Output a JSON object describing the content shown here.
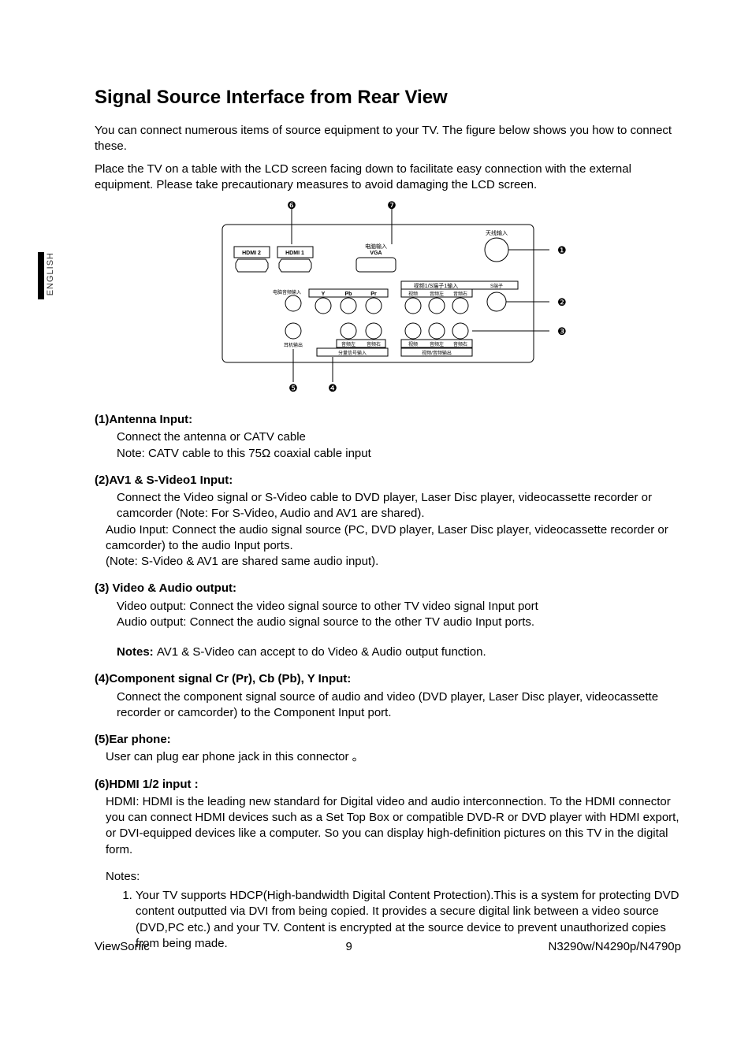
{
  "sideTab": "ENGLISH",
  "title": "Signal Source Interface from Rear View",
  "intro1": "You can connect numerous items of source equipment to your TV. The figure below shows you how to connect these.",
  "intro2": "Place the TV on a table with the LCD screen facing down to facilitate easy connection with the external equipment. Please take precautionary measures to avoid damaging the LCD screen.",
  "diagram": {
    "callouts": {
      "c1": "❶",
      "c2": "❷",
      "c3": "❸",
      "c4": "❹",
      "c5": "❺",
      "c6": "❻",
      "c7": "❼"
    },
    "labels": {
      "hdmi2": "HDMI 2",
      "hdmi1": "HDMI 1",
      "vga_top": "电脑输入",
      "vga_bot": "VGA",
      "ant": "天线输入",
      "row2hdr": "视频1/S端子1输入",
      "svideo": "S端子",
      "pcaudio": "电脑音频输入",
      "y": "Y",
      "pb": "Pb",
      "pr": "Pr",
      "vid": "视频",
      "aL": "音频左",
      "aR": "音频右",
      "ear": "耳机输出",
      "comp_in": "分量信号输入",
      "av_out": "视频/音频输出",
      "aL2": "音频左",
      "aR2": "音频右",
      "vid2": "视频",
      "aL3": "音频左",
      "aR3": "音频右"
    }
  },
  "items": [
    {
      "head": "(1)Antenna Input:",
      "body": [
        "Connect the antenna or CATV cable",
        "Note: CATV cable to this 75Ω coaxial cable input"
      ]
    },
    {
      "head": "(2)AV1 & S-Video1 Input:",
      "body": [
        "Connect the Video signal or S-Video cable to DVD player, Laser Disc player, videocassette recorder or camcorder (Note: For S-Video, Audio and AV1 are shared).",
        "Audio Input: Connect the audio signal source (PC, DVD player, Laser Disc player, videocassette recorder or camcorder) to the audio Input ports.",
        "(Note: S-Video & AV1 are shared same audio input)."
      ],
      "bodySub": true
    },
    {
      "head": "(3) Video & Audio output:",
      "body": [
        "Video output: Connect the video signal source to other TV video signal Input port",
        "Audio output: Connect the audio signal source to the other TV audio Input ports."
      ],
      "extraNote": "AV1 & S-Video can accept to do Video & Audio output function.",
      "extraNoteLabel": "Notes: "
    },
    {
      "head": "(4)Component signal Cr (Pr), Cb (Pb), Y Input:",
      "body": [
        "Connect the component signal source of audio and video (DVD player, Laser Disc player, videocassette recorder or camcorder) to the Component Input port."
      ]
    },
    {
      "head": "(5)Ear phone:",
      "body": [
        "User can plug ear phone jack in this connector 。"
      ],
      "bodyNoIndent": true
    },
    {
      "head": "(6)HDMI 1/2 input :",
      "body": [
        "HDMI: HDMI is the leading new standard for Digital video and audio interconnection. To the HDMI connector you can connect HDMI devices such as a Set Top Box or compatible DVD-R or DVD player with HDMI export, or DVI-equipped devices like a computer. So you can display high-definition pictures on this TV in the digital form."
      ],
      "bodyNoIndent": true,
      "notesHead": "Notes:",
      "notesList": [
        "Your TV supports HDCP(High-bandwidth Digital Content Protection).This is a system for protecting DVD content outputted via DVI from being copied. It provides a secure digital link between a video source (DVD,PC etc.) and your TV. Content is encrypted at the source device to prevent unauthorized copies from being made."
      ]
    }
  ],
  "footer": {
    "brand": "ViewSonic",
    "page": "9",
    "model": "N3290w/N4290p/N4790p"
  }
}
